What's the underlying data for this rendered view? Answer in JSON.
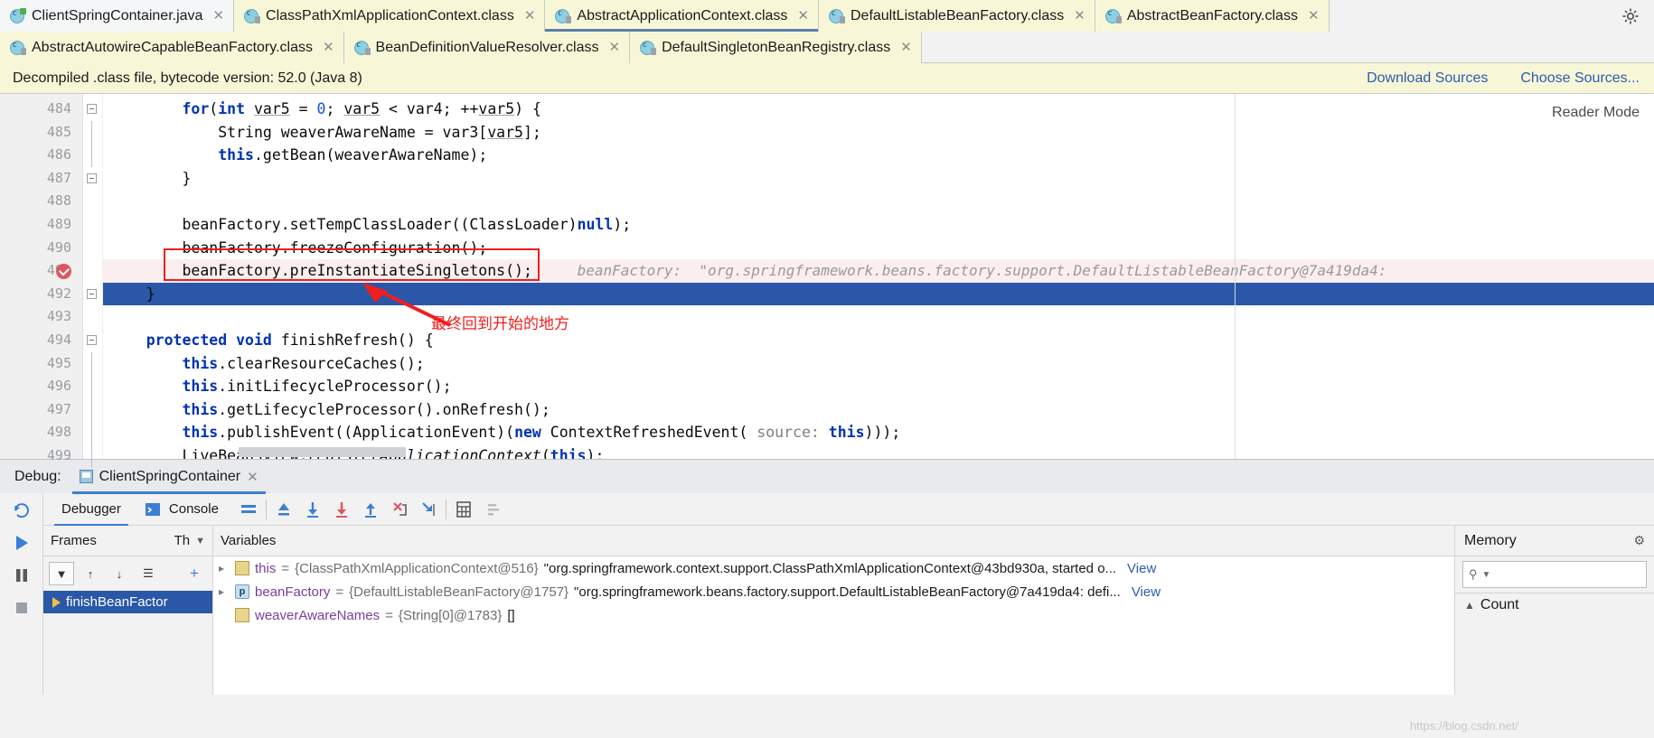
{
  "tabs_row1": [
    {
      "label": "ClientSpringContainer.java",
      "icon": "java-class-icon",
      "state": "inactive-white"
    },
    {
      "label": "ClassPathXmlApplicationContext.class",
      "icon": "class-file-icon",
      "state": "inactive-yellow"
    },
    {
      "label": "AbstractApplicationContext.class",
      "icon": "class-file-icon",
      "state": "active"
    },
    {
      "label": "DefaultListableBeanFactory.class",
      "icon": "class-file-icon",
      "state": "inactive-yellow"
    },
    {
      "label": "AbstractBeanFactory.class",
      "icon": "class-file-icon",
      "state": "inactive-yellow"
    }
  ],
  "tabs_row2": [
    {
      "label": "AbstractAutowireCapableBeanFactory.class",
      "icon": "class-file-icon",
      "state": "inactive-yellow"
    },
    {
      "label": "BeanDefinitionValueResolver.class",
      "icon": "class-file-icon",
      "state": "inactive-yellow"
    },
    {
      "label": "DefaultSingletonBeanRegistry.class",
      "icon": "class-file-icon",
      "state": "inactive-yellow"
    }
  ],
  "notice": {
    "message": "Decompiled .class file, bytecode version: 52.0 (Java 8)",
    "download_sources": "Download Sources",
    "choose_sources": "Choose Sources..."
  },
  "editor": {
    "reader_mode": "Reader Mode",
    "line_numbers": [
      "484",
      "485",
      "486",
      "487",
      "488",
      "489",
      "490",
      "491",
      "492",
      "493",
      "494",
      "495",
      "496",
      "497",
      "498",
      "499"
    ],
    "inline_hint": "beanFactory:  \"org.springframework.beans.factory.support.DefaultListableBeanFactory@7a419da4:",
    "annotation": "最终回到开始的地方"
  },
  "debug": {
    "label": "Debug:",
    "session_tab": "ClientSpringContainer",
    "tabs": [
      {
        "label": "Debugger",
        "selected": true
      },
      {
        "label": "Console",
        "selected": false
      }
    ],
    "frames_header": "Frames",
    "threads_header": "Th",
    "variables_header": "Variables",
    "frame_item": "finishBeanFactor",
    "memory_header": "Memory",
    "memory_search_placeholder": "",
    "memory_count_label": "Count",
    "variables": [
      {
        "name": "this",
        "eq": "=",
        "type": "{ClassPathXmlApplicationContext@516}",
        "value": "\"org.springframework.context.support.ClassPathXmlApplicationContext@43bd930a, started o...",
        "link": "View",
        "icon": "object-icon"
      },
      {
        "name": "beanFactory",
        "eq": "=",
        "type": "{DefaultListableBeanFactory@1757}",
        "value": "\"org.springframework.beans.factory.support.DefaultListableBeanFactory@7a419da4: defi...",
        "link": "View",
        "icon": "param-field-icon"
      },
      {
        "name": "weaverAwareNames",
        "eq": "=",
        "type": "{String[0]@1783}",
        "value": "[]",
        "link": "",
        "icon": "array-icon"
      }
    ]
  },
  "watermark": "https://blog.csdn.net/"
}
